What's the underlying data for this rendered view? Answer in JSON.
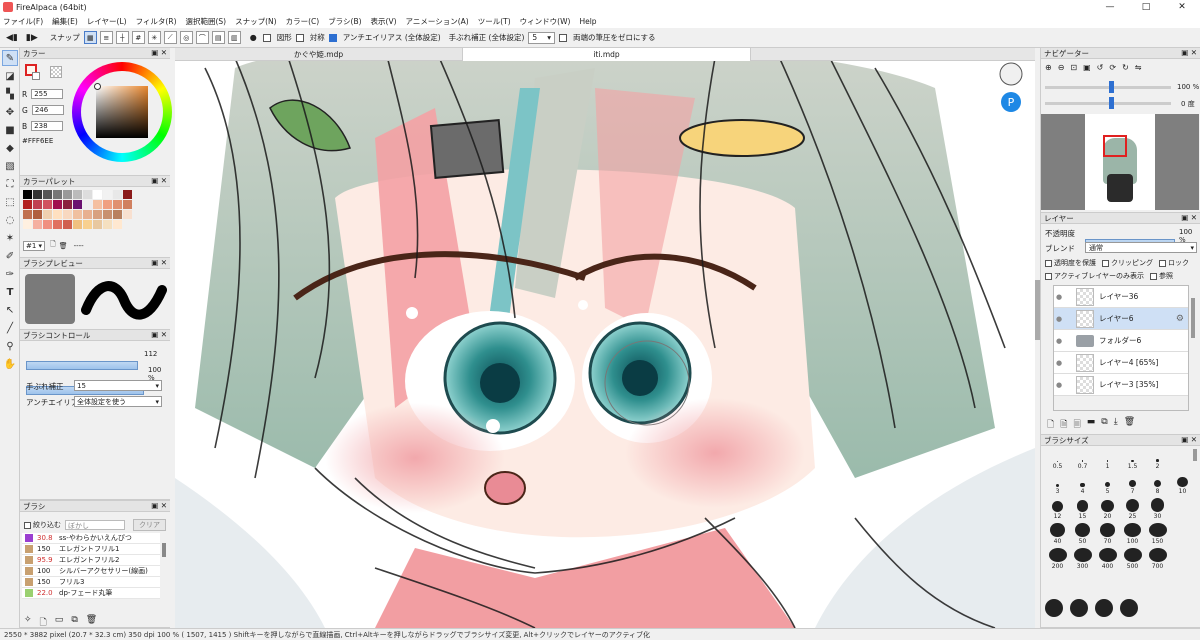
{
  "app": {
    "title": "FireAlpaca (64bit)"
  },
  "window_controls": {
    "minimize": "—",
    "maximize": "□",
    "close": "✕"
  },
  "menu": [
    "ファイル(F)",
    "編集(E)",
    "レイヤー(L)",
    "フィルタ(R)",
    "選択範囲(S)",
    "スナップ(N)",
    "カラー(C)",
    "ブラシ(B)",
    "表示(V)",
    "アニメーション(A)",
    "ツール(T)",
    "ウィンドウ(W)",
    "Help"
  ],
  "toolbar": {
    "snap_label": "スナップ",
    "figure_label": "図形",
    "symmetry_label": "対称",
    "antialias_label": "アンチエイリアス (全体設定)",
    "stabilizer_label": "手ぶれ補正 (全体設定)",
    "stabilizer_value": "5",
    "both_ends_label": "両端の筆圧をゼロにする"
  },
  "tabs": [
    {
      "label": "かぐや姫.mdp"
    },
    {
      "label": "iti.mdp"
    }
  ],
  "color_panel": {
    "title": "カラー",
    "r_label": "R",
    "r_value": "255",
    "g_label": "G",
    "g_value": "246",
    "b_label": "B",
    "b_value": "238",
    "hex": "#FFF6EE"
  },
  "palette_panel": {
    "title": "カラーパレット",
    "set_label": "#1",
    "dashes": "----",
    "colors": [
      "#000000",
      "#333333",
      "#555555",
      "#777777",
      "#999999",
      "#bbbbbb",
      "#dddddd",
      "#ffffff",
      "#f2f2f2",
      "#e8e8e8",
      "#8b1a1a",
      "#b22222",
      "#c04050",
      "#d05060",
      "#a01050",
      "#8a2040",
      "#6a1070",
      "#eeeeee",
      "#f5c0a0",
      "#f0a080",
      "#e09070",
      "#d08060",
      "#c07050",
      "#b06040",
      "#f0d0b0",
      "#ffe0c0",
      "#f8d8c0",
      "#f0c0a0",
      "#e8b090",
      "#d8a080",
      "#c89070",
      "#b88060",
      "#f8e0d0",
      "#fff0e0",
      "#f5b0a0",
      "#f09080",
      "#e07060",
      "#d06050",
      "#f0c080",
      "#f8d090",
      "#e8c8a0",
      "#f5e0c0",
      "#ffe8d0"
    ]
  },
  "brush_preview": {
    "title": "ブラシプレビュー"
  },
  "brush_control": {
    "title": "ブラシコントロール",
    "size_value": "112",
    "opacity_value": "100",
    "opacity_unit": "%",
    "stabilizer_label": "手ぶれ補正",
    "stabilizer_value": "15",
    "antialias_label": "アンチエイリアス",
    "antialias_value": "全体設定を使う"
  },
  "brush_panel": {
    "title": "ブラシ",
    "filter_label": "絞り込む",
    "blur_label": "ぼかし",
    "clear_label": "クリア",
    "items": [
      {
        "size": "30.8",
        "name": "ss-やわらかいえんぴつ",
        "color": "#9b3fd0",
        "size_color": "#d03030"
      },
      {
        "size": "150",
        "name": "エレガントフリル1",
        "color": "#c8a070",
        "size_color": "#222222"
      },
      {
        "size": "95.9",
        "name": "エレガントフリル2",
        "color": "#c8a070",
        "size_color": "#d03030"
      },
      {
        "size": "100",
        "name": "シルバーアクセサリー(線画)",
        "color": "#c8a070",
        "size_color": "#222222"
      },
      {
        "size": "150",
        "name": "フリル3",
        "color": "#c8a070",
        "size_color": "#222222"
      },
      {
        "size": "22.0",
        "name": "dp-フェード丸筆",
        "color": "#9ad070",
        "size_color": "#d03030"
      }
    ]
  },
  "navigator": {
    "title": "ナビゲーター",
    "zoom_value": "100",
    "zoom_unit": "%",
    "rotate_value": "0",
    "rotate_unit": "度"
  },
  "layer_panel": {
    "title": "レイヤー",
    "opacity_label": "不透明度",
    "opacity_value": "100",
    "opacity_unit": "%",
    "blend_label": "ブレンド",
    "blend_value": "通常",
    "protect_label": "透明度を保護",
    "clipping_label": "クリッピング",
    "lock_label": "ロック",
    "active_only_label": "アクティブレイヤーのみ表示",
    "reference_label": "参照",
    "layers": [
      {
        "name": "レイヤー36",
        "active": false
      },
      {
        "name": "レイヤー6",
        "active": true
      },
      {
        "name": "フォルダー6",
        "active": false
      },
      {
        "name": "レイヤー4 [65%]",
        "active": false
      },
      {
        "name": "レイヤー3 [35%]",
        "active": false
      }
    ]
  },
  "brush_size_panel": {
    "title": "ブラシサイズ",
    "sizes": [
      "0.5",
      "0.7",
      "1",
      "1.5",
      "2",
      "",
      "3",
      "4",
      "5",
      "7",
      "8",
      "10",
      "12",
      "15",
      "20",
      "25",
      "30",
      "",
      "40",
      "50",
      "70",
      "100",
      "150",
      "",
      "200",
      "300",
      "400",
      "500",
      "700",
      "",
      "",
      "",
      ""
    ]
  },
  "status": {
    "text": "2550 * 3882 pixel  (20.7 * 32.3 cm)  350 dpi  100 %  ( 1507, 1415 )  Shiftキーを押しながらで直線描画, Ctrl+Altキーを押しながらドラッグでブラシサイズ変更, Alt+クリックでレイヤーのアクティブ化"
  }
}
